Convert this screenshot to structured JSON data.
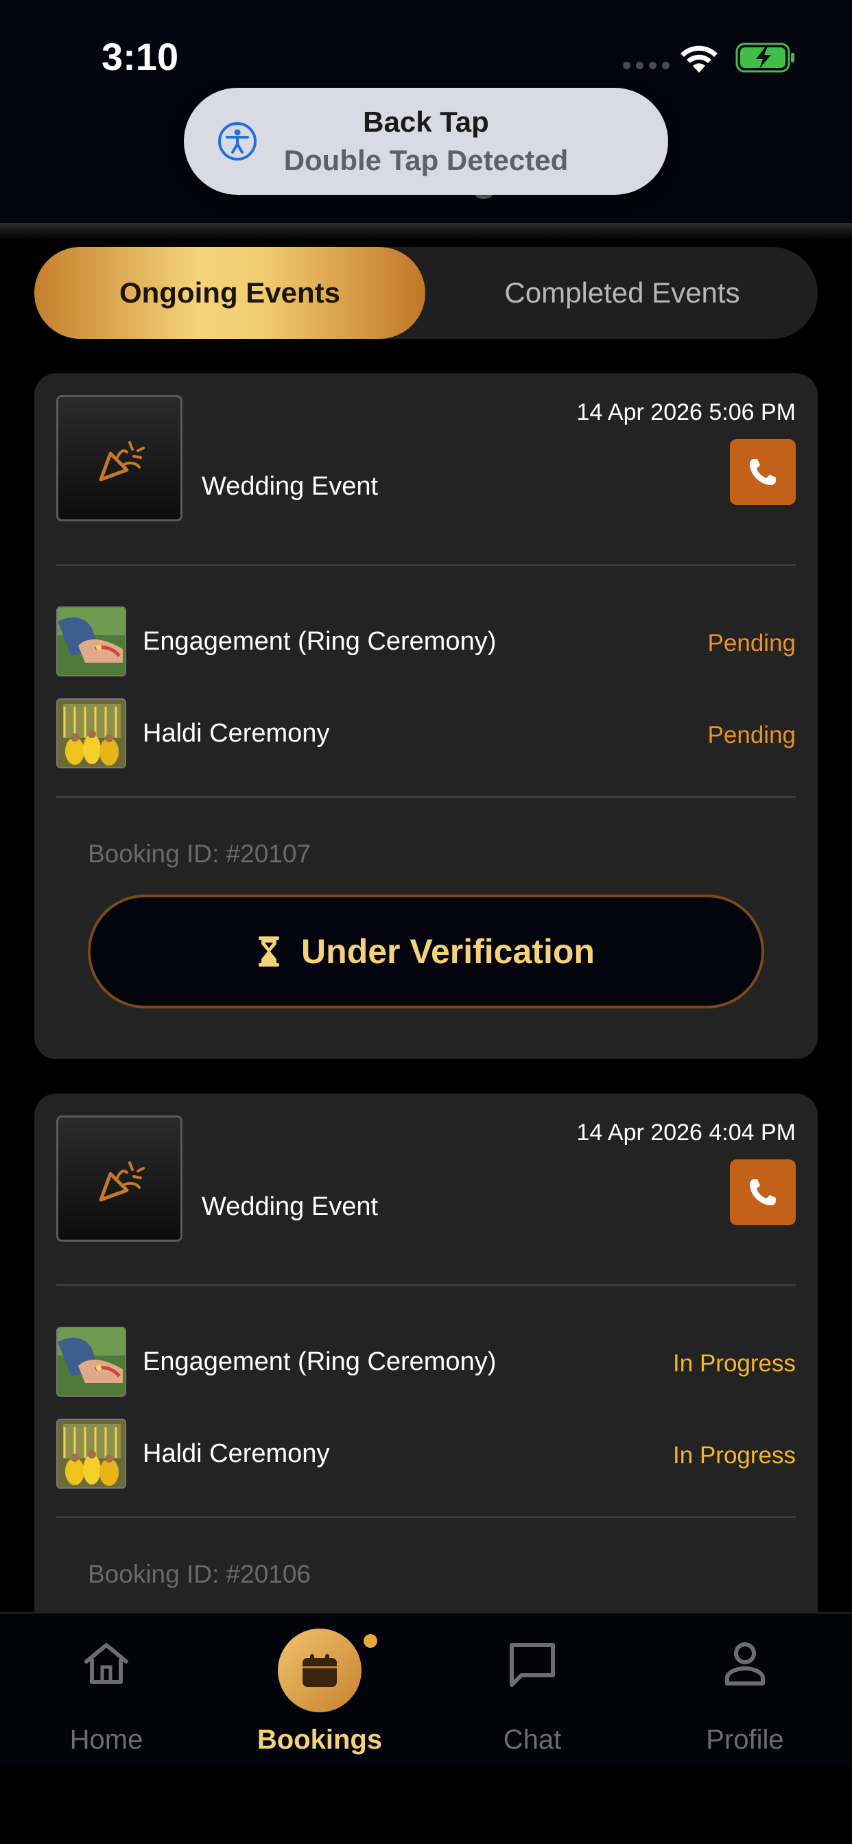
{
  "status_bar": {
    "time": "3:10"
  },
  "header": {
    "title": "Bookings"
  },
  "toast": {
    "title": "Back Tap",
    "subtitle": "Double Tap Detected"
  },
  "tabs": {
    "active": "Ongoing Events",
    "inactive": "Completed Events"
  },
  "cards": [
    {
      "event_name": "Wedding Event",
      "date": "14 Apr 2026 5:06 PM",
      "services": [
        {
          "name": "Engagement (Ring Ceremony)",
          "status": "Pending"
        },
        {
          "name": "Haldi Ceremony",
          "status": "Pending"
        }
      ],
      "booking_id": "Booking ID: #20107",
      "action_label": "Under Verification"
    },
    {
      "event_name": "Wedding Event",
      "date": "14 Apr 2026 4:04 PM",
      "services": [
        {
          "name": "Engagement (Ring Ceremony)",
          "status": "In Progress"
        },
        {
          "name": "Haldi Ceremony",
          "status": "In Progress"
        }
      ],
      "booking_id": "Booking ID: #20106"
    }
  ],
  "nav": {
    "home": "Home",
    "bookings": "Bookings",
    "chat": "Chat",
    "profile": "Profile"
  },
  "colors": {
    "accent_gold": "#f3d27a",
    "call_button": "#c2611a",
    "pending": "#e6922a",
    "in_progress": "#f2b62b"
  },
  "icons": [
    "party-popper-icon",
    "phone-icon",
    "hourglass-icon",
    "home-icon",
    "calendar-icon",
    "chat-icon",
    "profile-icon",
    "accessibility-icon",
    "wifi-icon",
    "battery-icon"
  ]
}
